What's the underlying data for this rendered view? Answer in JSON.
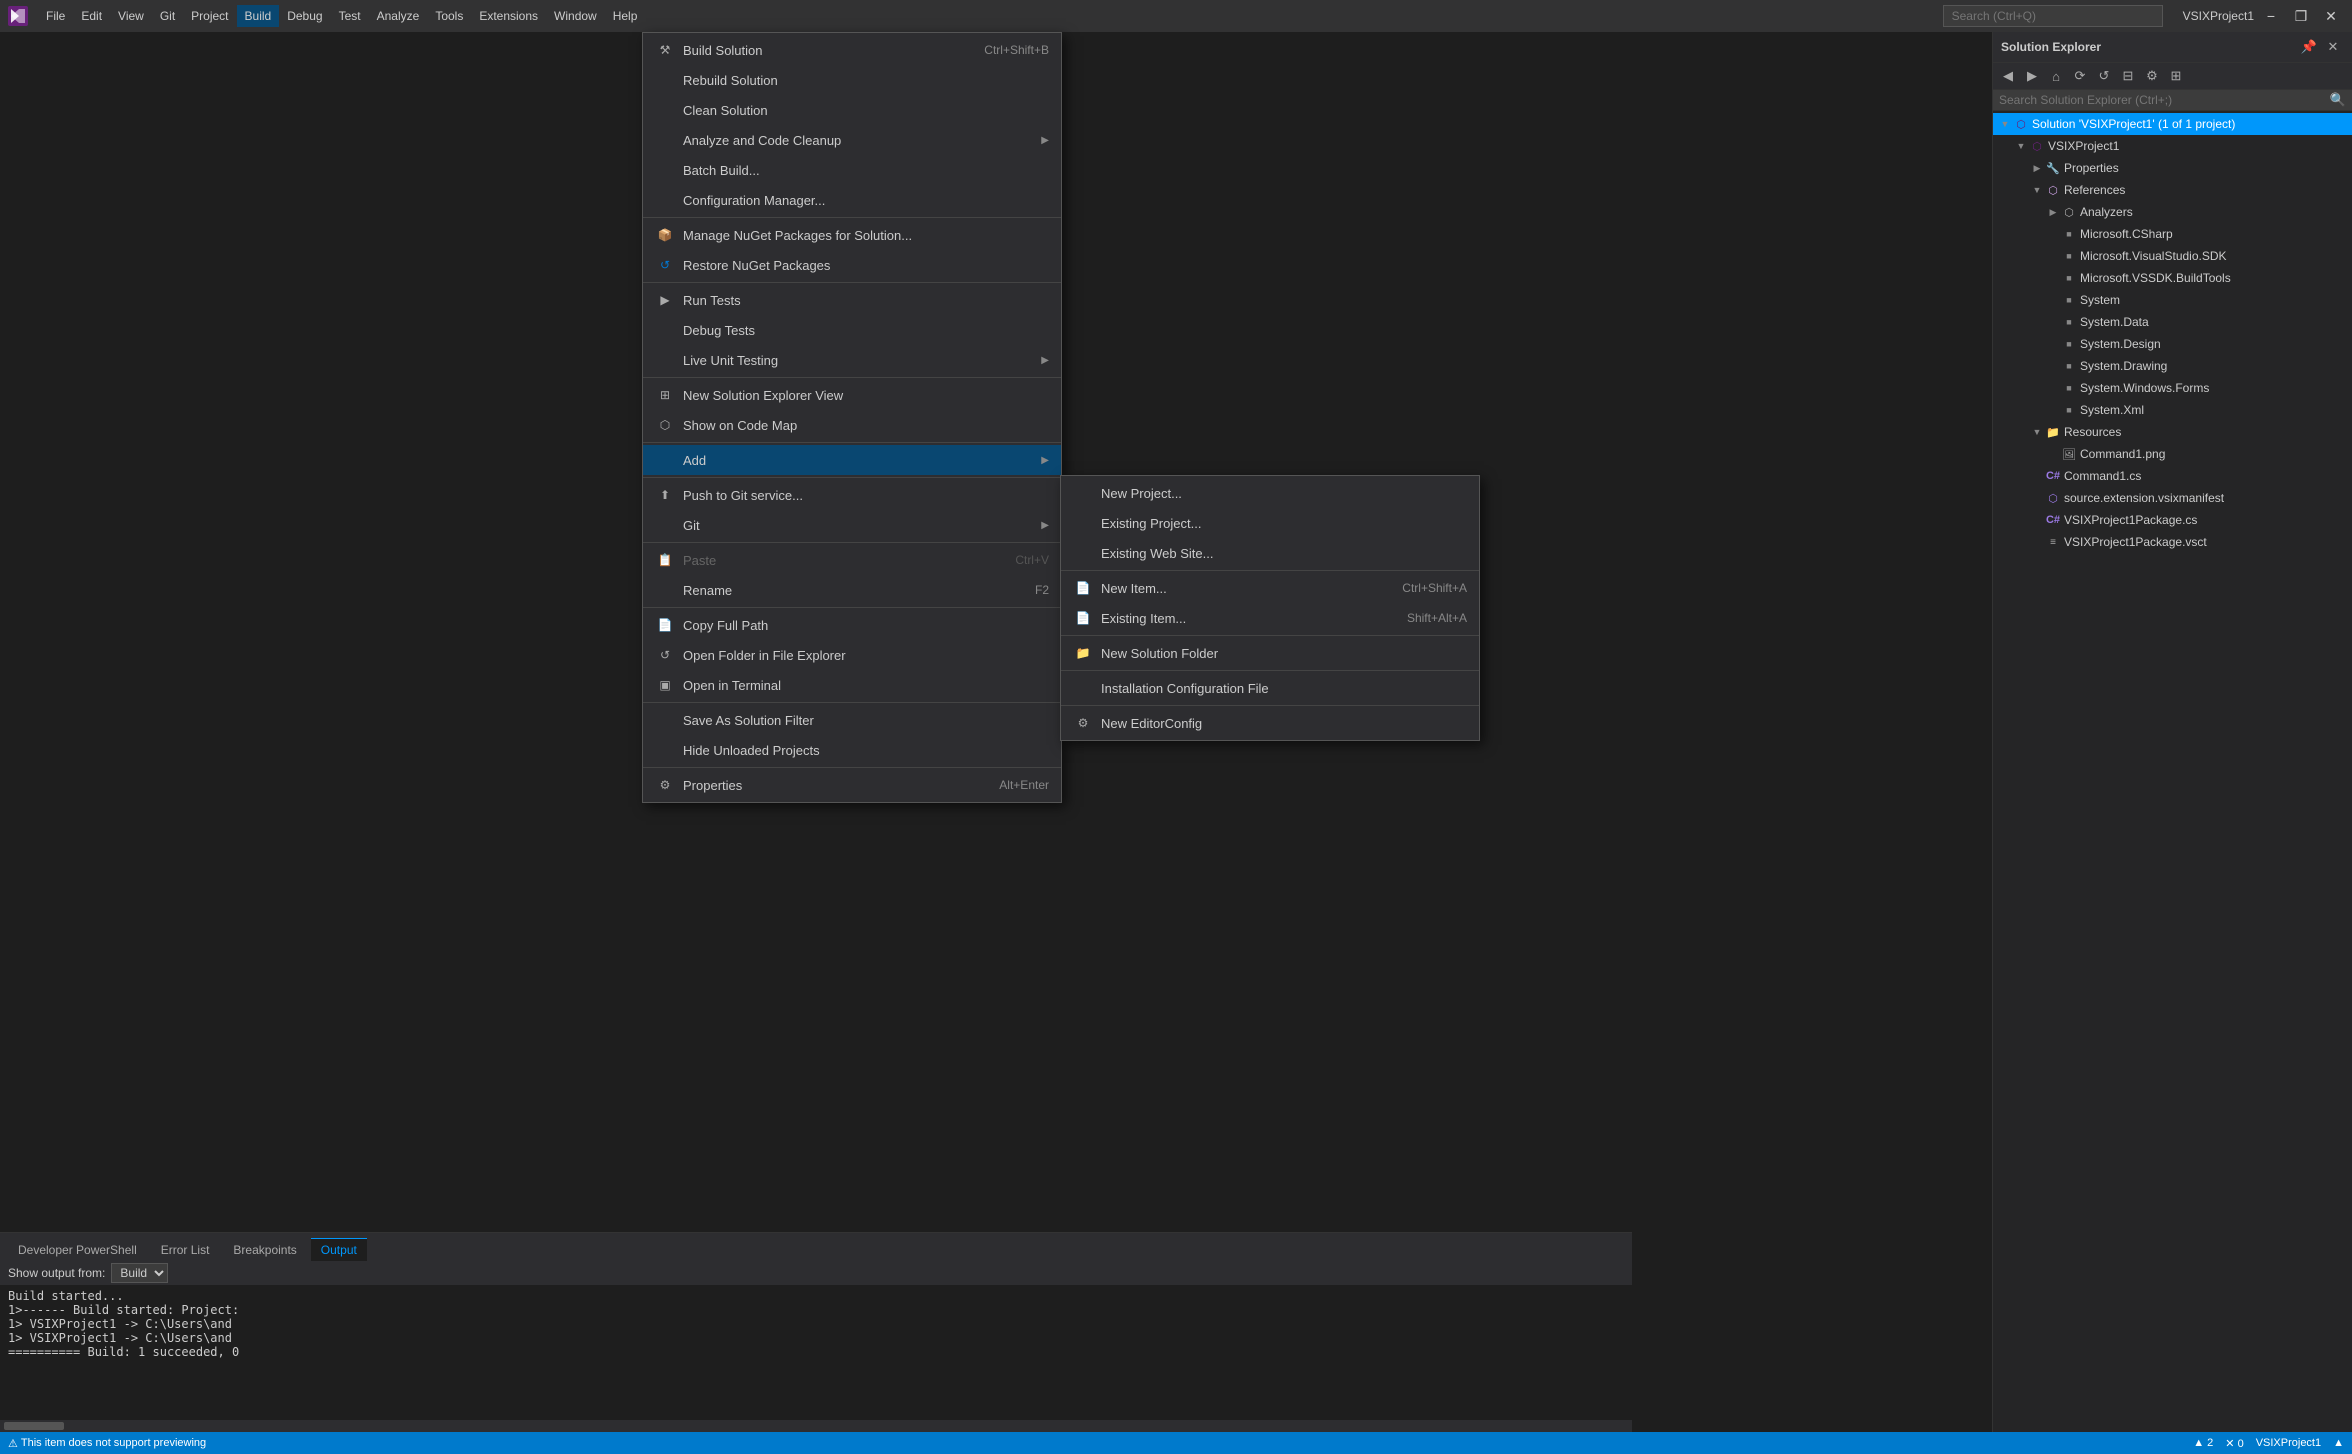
{
  "titleBar": {
    "appName": "VSIXProject1",
    "menuItems": [
      "File",
      "Edit",
      "View",
      "Git",
      "Project",
      "Build",
      "Debug",
      "Test",
      "Analyze",
      "Tools",
      "Extensions",
      "Window",
      "Help"
    ],
    "searchPlaceholder": "Search (Ctrl+Q)",
    "minimizeLabel": "−",
    "restoreLabel": "❐",
    "closeLabel": "✕"
  },
  "buildMenu": {
    "items": [
      {
        "label": "Build Solution",
        "shortcut": "Ctrl+Shift+B",
        "icon": ""
      },
      {
        "label": "Rebuild Solution",
        "shortcut": "",
        "icon": ""
      },
      {
        "label": "Clean Solution",
        "shortcut": "",
        "icon": ""
      },
      {
        "label": "Analyze and Code Cleanup",
        "shortcut": "",
        "icon": "",
        "hasSubmenu": true
      },
      {
        "label": "Batch Build...",
        "shortcut": "",
        "icon": ""
      },
      {
        "label": "Configuration Manager...",
        "shortcut": "",
        "icon": ""
      },
      {
        "separator": true
      },
      {
        "label": "Manage NuGet Packages for Solution...",
        "shortcut": "",
        "icon": "nuget"
      },
      {
        "label": "Restore NuGet Packages",
        "shortcut": "",
        "icon": "restore"
      },
      {
        "separator": true
      },
      {
        "label": "Run Tests",
        "shortcut": "",
        "icon": "test"
      },
      {
        "label": "Debug Tests",
        "shortcut": "",
        "icon": ""
      },
      {
        "label": "Live Unit Testing",
        "shortcut": "",
        "icon": "",
        "hasSubmenu": true
      },
      {
        "separator": true
      },
      {
        "label": "New Solution Explorer View",
        "shortcut": "",
        "icon": "view"
      },
      {
        "label": "Show on Code Map",
        "shortcut": "",
        "icon": "map"
      },
      {
        "separator": true
      },
      {
        "label": "Add",
        "shortcut": "",
        "icon": "",
        "hasSubmenu": true,
        "highlighted": true
      },
      {
        "separator": true
      },
      {
        "label": "Push to Git service...",
        "shortcut": "",
        "icon": "git"
      },
      {
        "label": "Git",
        "shortcut": "",
        "icon": "",
        "hasSubmenu": true
      },
      {
        "separator": true
      },
      {
        "label": "Paste",
        "shortcut": "Ctrl+V",
        "icon": "paste",
        "disabled": true
      },
      {
        "label": "Rename",
        "shortcut": "F2",
        "icon": ""
      },
      {
        "separator": true
      },
      {
        "label": "Copy Full Path",
        "shortcut": "",
        "icon": "copy"
      },
      {
        "label": "Open Folder in File Explorer",
        "shortcut": "",
        "icon": "folder"
      },
      {
        "label": "Open in Terminal",
        "shortcut": "",
        "icon": "terminal"
      },
      {
        "separator": true
      },
      {
        "label": "Save As Solution Filter",
        "shortcut": "",
        "icon": ""
      },
      {
        "label": "Hide Unloaded Projects",
        "shortcut": "",
        "icon": ""
      },
      {
        "separator": true
      },
      {
        "label": "Properties",
        "shortcut": "Alt+Enter",
        "icon": "props"
      }
    ]
  },
  "addSubmenu": {
    "items": [
      {
        "label": "New Project...",
        "shortcut": ""
      },
      {
        "label": "Existing Project...",
        "shortcut": ""
      },
      {
        "label": "Existing Web Site...",
        "shortcut": ""
      },
      {
        "separator": true
      },
      {
        "label": "New Item...",
        "shortcut": "Ctrl+Shift+A",
        "icon": "newitem"
      },
      {
        "label": "Existing Item...",
        "shortcut": "Shift+Alt+A",
        "icon": "existingitem"
      },
      {
        "separator": true
      },
      {
        "label": "New Solution Folder",
        "shortcut": "",
        "icon": "folder"
      },
      {
        "separator": true
      },
      {
        "label": "Installation Configuration File",
        "shortcut": "",
        "icon": ""
      },
      {
        "separator": true
      },
      {
        "label": "New EditorConfig",
        "shortcut": "",
        "icon": "editorconfig"
      }
    ]
  },
  "solutionExplorer": {
    "title": "Solution Explorer",
    "searchPlaceholder": "Search Solution Explorer (Ctrl+;)",
    "tree": [
      {
        "label": "Solution 'VSIXProject1' (1 of 1 project)",
        "level": 0,
        "type": "solution",
        "expanded": true,
        "selected": true
      },
      {
        "label": "VSIXProject1",
        "level": 1,
        "type": "project",
        "expanded": true
      },
      {
        "label": "Properties",
        "level": 2,
        "type": "properties",
        "expanded": false
      },
      {
        "label": "References",
        "level": 2,
        "type": "references",
        "expanded": true
      },
      {
        "label": "Analyzers",
        "level": 3,
        "type": "analyzer",
        "expanded": false
      },
      {
        "label": "Microsoft.CSharp",
        "level": 3,
        "type": "ref"
      },
      {
        "label": "Microsoft.VisualStudio.SDK",
        "level": 3,
        "type": "ref"
      },
      {
        "label": "Microsoft.VSSDK.BuildTools",
        "level": 3,
        "type": "ref"
      },
      {
        "label": "System",
        "level": 3,
        "type": "ref"
      },
      {
        "label": "System.Data",
        "level": 3,
        "type": "ref"
      },
      {
        "label": "System.Design",
        "level": 3,
        "type": "ref"
      },
      {
        "label": "System.Drawing",
        "level": 3,
        "type": "ref"
      },
      {
        "label": "System.Windows.Forms",
        "level": 3,
        "type": "ref"
      },
      {
        "label": "System.Xml",
        "level": 3,
        "type": "ref"
      },
      {
        "label": "Resources",
        "level": 2,
        "type": "folder",
        "expanded": true
      },
      {
        "label": "Command1.png",
        "level": 3,
        "type": "image"
      },
      {
        "label": "Command1.cs",
        "level": 2,
        "type": "csharp"
      },
      {
        "label": "source.extension.vsixmanifest",
        "level": 2,
        "type": "manifest"
      },
      {
        "label": "VSIXProject1Package.cs",
        "level": 2,
        "type": "csharp"
      },
      {
        "label": "VSIXProject1Package.vsct",
        "level": 2,
        "type": "vsct"
      }
    ]
  },
  "outputPanel": {
    "tabs": [
      "Developer PowerShell",
      "Error List",
      "Breakpoints",
      "Output"
    ],
    "activeTab": "Output",
    "showOutputFrom": "Build",
    "content": [
      "Build started...",
      "1>------ Build started: Project:",
      "1>   VSIXProject1 -> C:\\Users\\and",
      "1>   VSIXProject1 -> C:\\Users\\and",
      "========== Build: 1 succeeded, 0"
    ]
  },
  "statusBar": {
    "items": [
      "▲ 2",
      "✕ 0"
    ],
    "rightItems": [
      "VSIXProject1"
    ],
    "message": "This item does not support previewing"
  }
}
